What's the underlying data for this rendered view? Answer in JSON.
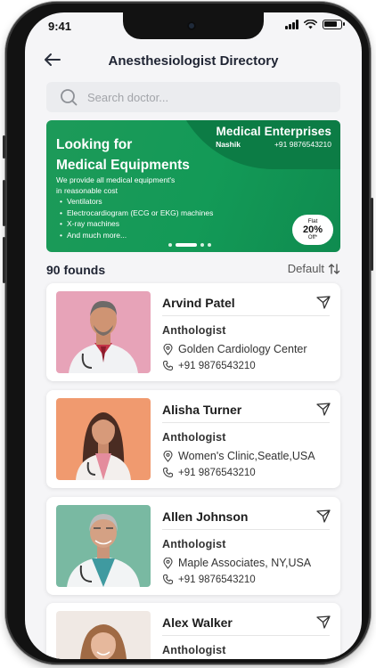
{
  "status_bar": {
    "time": "9:41"
  },
  "header": {
    "title": "Anesthesiologist Directory"
  },
  "search": {
    "placeholder": "Search doctor..."
  },
  "banner": {
    "heading_line1": "Looking for",
    "heading_line2": "Medical Equipments",
    "subtitle_line1": "We provide all medical equipment's",
    "subtitle_line2": "in reasonable cost",
    "items": [
      "Ventilators",
      "Electrocardiogram (ECG or EKG) machines",
      "X-ray machines",
      "And much more..."
    ],
    "brand_name": "Medical Enterprises",
    "brand_city": "Nashik",
    "brand_phone": "+91 9876543210",
    "offer_top": "Flat",
    "offer_percent": "20%",
    "offer_bottom": "Off*",
    "carousel_active_index": 1,
    "carousel_count": 4
  },
  "results": {
    "count_label": "90 founds",
    "sort_label": "Default"
  },
  "doctors": [
    {
      "name": "Arvind Patel",
      "specialty": "Anthologist",
      "location": "Golden Cardiology Center",
      "phone": "+91 9876543210"
    },
    {
      "name": "Alisha Turner",
      "specialty": "Anthologist",
      "location": "Women's Clinic,Seatle,USA",
      "phone": "+91 9876543210"
    },
    {
      "name": "Allen Johnson",
      "specialty": "Anthologist",
      "location": "Maple Associates, NY,USA",
      "phone": "+91 9876543210"
    },
    {
      "name": "Alex Walker",
      "specialty": "Anthologist",
      "location": "",
      "phone": ""
    }
  ],
  "colors": {
    "banner_green": "#139a57",
    "banner_dark_green": "#0c7c45",
    "accent_text": "#1f2433"
  }
}
